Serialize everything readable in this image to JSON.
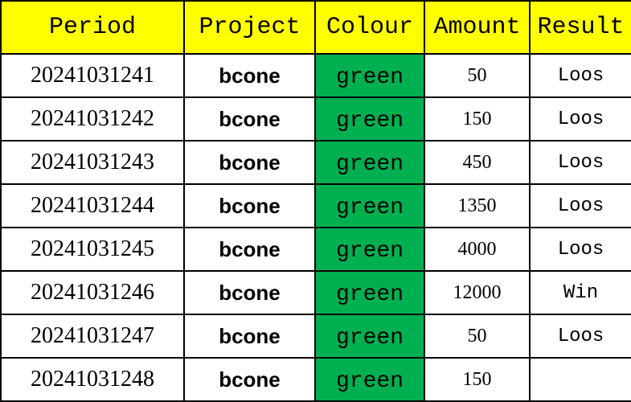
{
  "header": {
    "period": "Period",
    "project": "Project",
    "colour": "Colour",
    "amount": "Amount",
    "result": "Result"
  },
  "colors": {
    "header_bg": "#FFFF00",
    "green_cell": "#00B050"
  },
  "rows": [
    {
      "period": "20241031241",
      "project": "bcone",
      "colour": "green",
      "amount": "50",
      "result": "Loos"
    },
    {
      "period": "20241031242",
      "project": "bcone",
      "colour": "green",
      "amount": "150",
      "result": "Loos"
    },
    {
      "period": "20241031243",
      "project": "bcone",
      "colour": "green",
      "amount": "450",
      "result": "Loos"
    },
    {
      "period": "20241031244",
      "project": "bcone",
      "colour": "green",
      "amount": "1350",
      "result": "Loos"
    },
    {
      "period": "20241031245",
      "project": "bcone",
      "colour": "green",
      "amount": "4000",
      "result": "Loos"
    },
    {
      "period": "20241031246",
      "project": "bcone",
      "colour": "green",
      "amount": "12000",
      "result": "Win"
    },
    {
      "period": "20241031247",
      "project": "bcone",
      "colour": "green",
      "amount": "50",
      "result": "Loos"
    },
    {
      "period": "20241031248",
      "project": "bcone",
      "colour": "green",
      "amount": "150",
      "result": ""
    }
  ]
}
